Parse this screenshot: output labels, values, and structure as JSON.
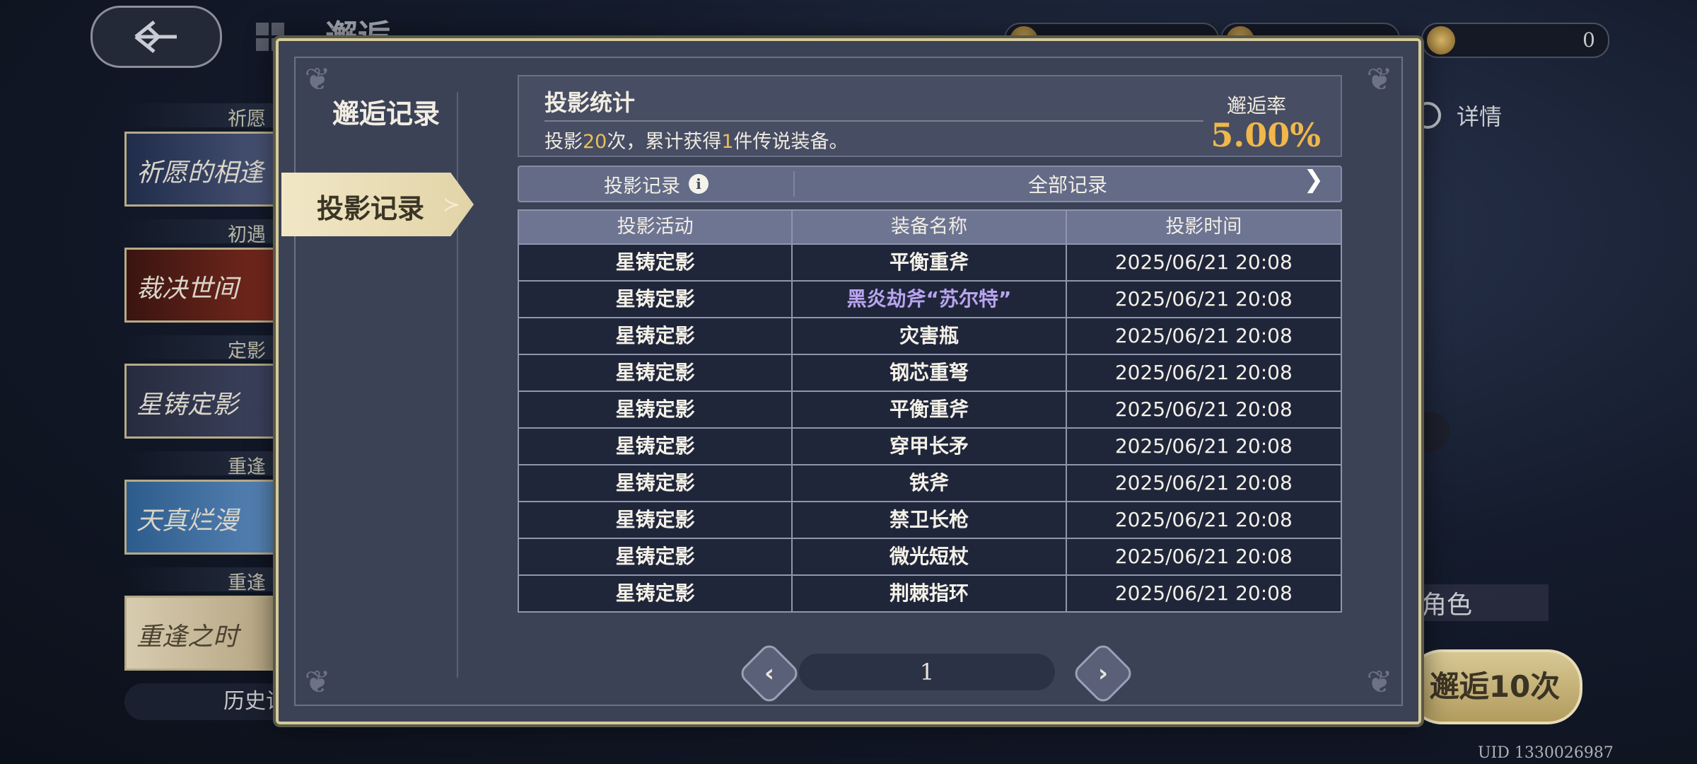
{
  "background": {
    "screen_title": "邂逅",
    "currencies": [
      "",
      "",
      "0"
    ],
    "banners": [
      {
        "label": "祈愿",
        "name": "祈愿的相逢"
      },
      {
        "label": "初遇",
        "name": "裁决世间"
      },
      {
        "label": "定影",
        "name": "星铸定影"
      },
      {
        "label": "重逢",
        "name": "天真烂漫"
      },
      {
        "label": "重逢",
        "name": "重逢之时"
      }
    ],
    "history_button": "历史记",
    "detail_label": "详情",
    "role_label": "角色",
    "pull_ten_label": "邂逅10次",
    "uid": "UID 1330026987"
  },
  "modal": {
    "sidebar_title": "邂逅记录",
    "active_tab": "投影记录",
    "stats": {
      "title": "投影统计",
      "text_prefix": "投影",
      "pull_count": "20",
      "text_mid": "次，累计获得",
      "legend_count": "1",
      "text_suffix": "件传说装备。",
      "rate_label": "邂逅率",
      "rate_value": "5.00%"
    },
    "record_bar": {
      "left_label": "投影记录",
      "filter_label": "全部记录"
    },
    "table": {
      "headers": [
        "投影活动",
        "装备名称",
        "投影时间"
      ],
      "rows": [
        {
          "activity": "星铸定影",
          "item": "平衡重斧",
          "time": "2025/06/21 20:08"
        },
        {
          "activity": "星铸定影",
          "item": "黑炎劫斧“苏尔特”",
          "time": "2025/06/21 20:08"
        },
        {
          "activity": "星铸定影",
          "item": "灾害瓶",
          "time": "2025/06/21 20:08"
        },
        {
          "activity": "星铸定影",
          "item": "钢芯重弩",
          "time": "2025/06/21 20:08"
        },
        {
          "activity": "星铸定影",
          "item": "平衡重斧",
          "time": "2025/06/21 20:08"
        },
        {
          "activity": "星铸定影",
          "item": "穿甲长矛",
          "time": "2025/06/21 20:08"
        },
        {
          "activity": "星铸定影",
          "item": "铁斧",
          "time": "2025/06/21 20:08"
        },
        {
          "activity": "星铸定影",
          "item": "禁卫长枪",
          "time": "2025/06/21 20:08"
        },
        {
          "activity": "星铸定影",
          "item": "微光短杖",
          "time": "2025/06/21 20:08"
        },
        {
          "activity": "星铸定影",
          "item": "荆棘指环",
          "time": "2025/06/21 20:08"
        }
      ]
    },
    "pagination": {
      "page": "1"
    }
  },
  "colors": {
    "accent_gold": "#f0b74a",
    "legendary": "#b9a4f0",
    "tab_active": "#f1e7c6"
  }
}
